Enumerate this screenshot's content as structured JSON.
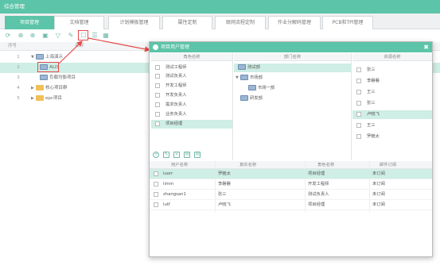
{
  "app": {
    "title": "综合管理"
  },
  "tabs": [
    {
      "label": "项目管理",
      "active": true
    },
    {
      "label": "文档管理",
      "active": false
    },
    {
      "label": "计划模板管理",
      "active": false
    },
    {
      "label": "属性定制",
      "active": false
    },
    {
      "label": "联网流程定制",
      "active": false
    },
    {
      "label": "作业分解码管理",
      "active": false
    },
    {
      "label": "PCB和TPl管理",
      "active": false
    }
  ],
  "tree_grid": {
    "headers": {
      "seq": "序号",
      "name": "名称"
    },
    "rows": [
      {
        "num": "1",
        "label": "上海演示",
        "level": 0,
        "expanded": true
      },
      {
        "num": "2",
        "label": "ALIS",
        "level": 1,
        "selected": true
      },
      {
        "num": "3",
        "label": "负载均衡项目",
        "level": 1
      },
      {
        "num": "4",
        "label": "核心项目群",
        "level": 0
      },
      {
        "num": "5",
        "label": "epc项目",
        "level": 0
      }
    ]
  },
  "dialog": {
    "title": "项目用户管理",
    "close": "✖",
    "roles": {
      "header": "角色名称",
      "items": [
        "测试工程师",
        "测试负责人",
        "开发工程师",
        "开发负责人",
        "需求负责人",
        "业务负责人",
        "项目经理"
      ],
      "selected_index": 6
    },
    "depts": {
      "header": "部门名称",
      "items": [
        {
          "label": "测试部",
          "level": 0,
          "selected": true
        },
        {
          "label": "市场部",
          "level": 0,
          "expanded": true
        },
        {
          "label": "市场一部",
          "level": 1
        },
        {
          "label": "研发部",
          "level": 0
        }
      ]
    },
    "resources": {
      "header": "资源名称",
      "items": [
        "张三",
        "李磐磐",
        "王三",
        "张三",
        "卢晓飞",
        "王三",
        "罗鲍太"
      ],
      "selected_index": 4
    },
    "user_grid": {
      "headers": [
        "用户名称",
        "真实名称",
        "角色名称",
        "邮件订阅"
      ],
      "rows": [
        [
          "luorr",
          "罗鲍太",
          "项目经理",
          "未订阅"
        ],
        [
          "limm",
          "李磐磐",
          "开发工程师",
          "未订阅"
        ],
        [
          "zhangsan1",
          "张三",
          "测试负责人",
          "未订阅"
        ],
        [
          "lutf",
          "卢晓飞",
          "项目经理",
          "未订阅"
        ]
      ],
      "selected_index": 0
    }
  },
  "colors": {
    "accent": "#5cc4a8",
    "selection": "#cfeee5",
    "annotation": "#e84a4a"
  }
}
